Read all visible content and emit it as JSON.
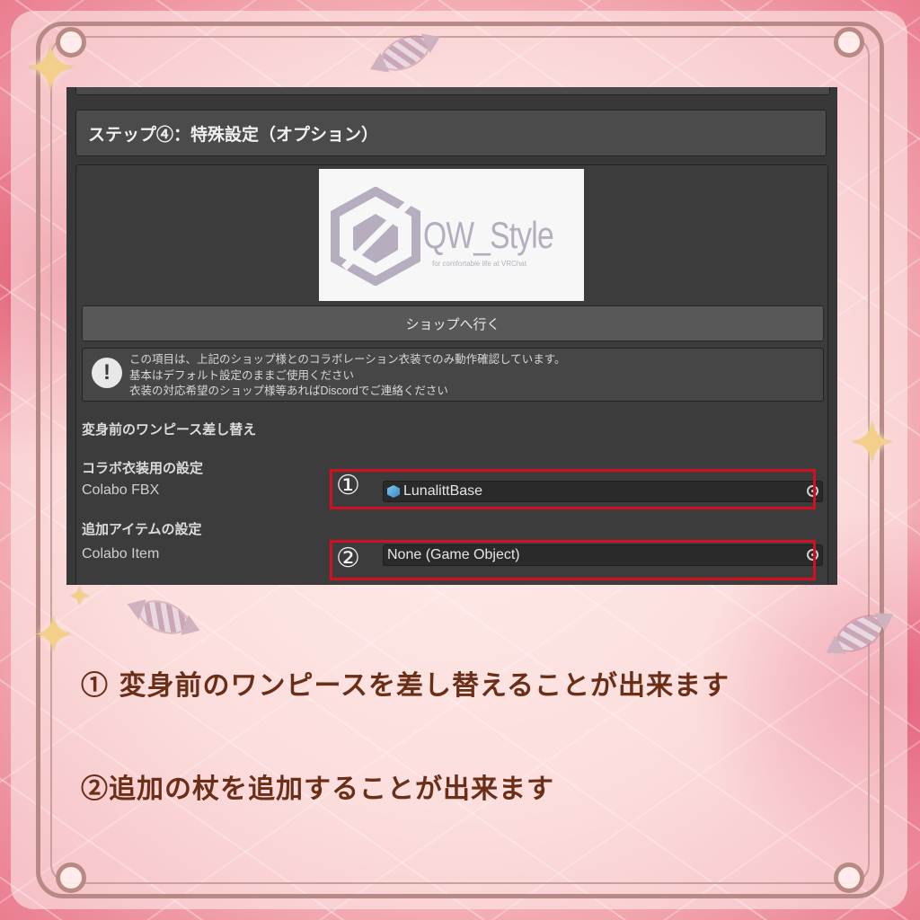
{
  "screenshot": {
    "step_header": "ステップ④：特殊設定（オプション）",
    "logo": {
      "name": "QW_Style",
      "tagline": "for comfortable life at VRChat"
    },
    "shop_button": "ショップへ行く",
    "help_box": {
      "icon": "exclamation-icon",
      "lines": [
        "この項目は、上記のショップ様とのコラボレーション衣装でのみ動作確認しています。",
        "基本はデフォルト設定のままご使用ください",
        "衣装の対応希望のショップ様等あればDiscordでご連絡ください"
      ]
    },
    "section_onepiece": "変身前のワンピース差し替え",
    "section_colabo": "コラボ衣装用の設定",
    "colabo_fbx": {
      "label": "Colabo FBX",
      "value": "LunalittBase",
      "icon": "prefab-cube-icon",
      "badge": "①"
    },
    "section_item": "追加アイテムの設定",
    "colabo_item": {
      "label": "Colabo Item",
      "value": "None (Game Object)",
      "badge": "②"
    },
    "highlight_color": "#d40f22"
  },
  "captions": {
    "line1": "① 変身前のワンピースを差し替えることが出来ます",
    "line2": "②追加の杖を追加することが出来ます"
  }
}
